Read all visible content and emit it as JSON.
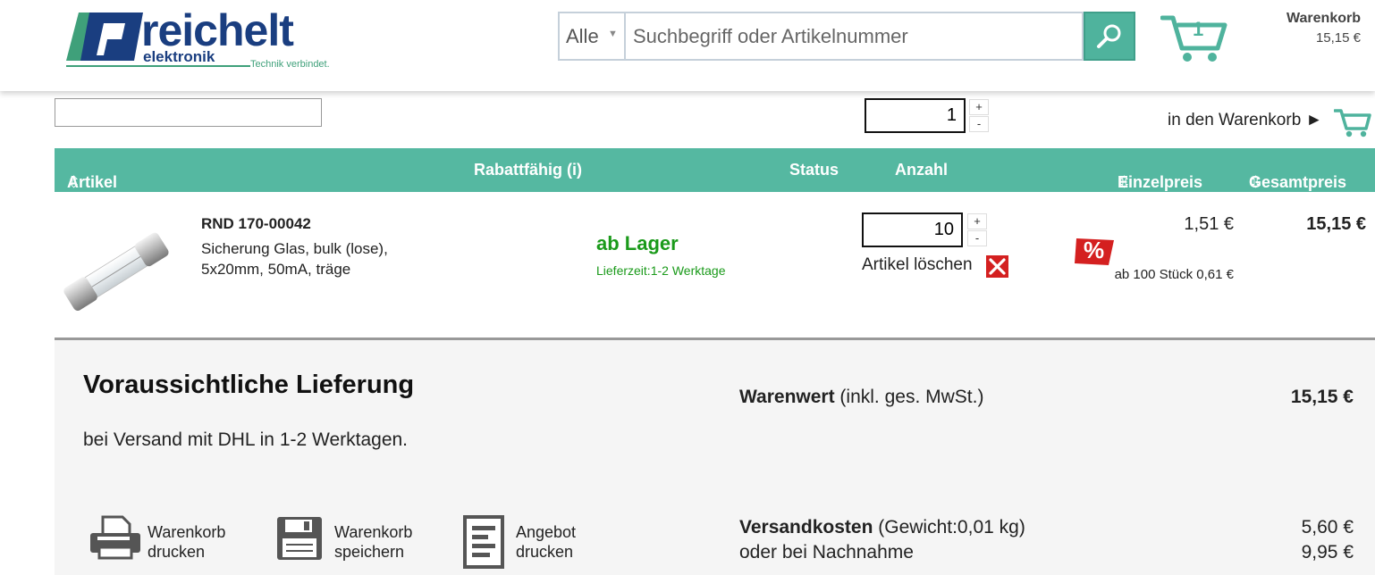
{
  "logo": {
    "word": "reichelt",
    "sub": "elektronik",
    "tagline": "Technik verbindet."
  },
  "search": {
    "category": "Alle",
    "placeholder": "Suchbegriff oder Artikelnummer"
  },
  "cart": {
    "count": "1",
    "label": "Warenkorb",
    "total": "15,15 €"
  },
  "toolbar": {
    "quantity": "1",
    "stepper_up": "+",
    "stepper_down": "-",
    "add_to_cart": "in den Warenkorb ►"
  },
  "table": {
    "columns": {
      "article": "Artikel",
      "discount": "Rabattfähig (i)",
      "status": "Status",
      "quantity": "Anzahl",
      "unit_price": "Einzelpreis",
      "total_price": "Gesamtpreis",
      "sort_glyph": "⇳"
    }
  },
  "item": {
    "sku": "RND 170-00042",
    "desc_line1": "Sicherung Glas, bulk (lose),",
    "desc_line2": "5x20mm, 50mA, träge",
    "stock": "ab Lager",
    "delivery": "Lieferzeit:1-2 Werktage",
    "quantity": "10",
    "delete_label": "Artikel löschen",
    "unit_price": "1,51 €",
    "discount_symbol": "%",
    "bulk_price": "ab 100 Stück 0,61 €",
    "total_price": "15,15 €"
  },
  "summary": {
    "delivery_title": "Voraussichtliche Lieferung",
    "delivery_text": "bei Versand mit DHL in 1-2 Werktagen.",
    "value_label_bold": "Warenwert",
    "value_label_rest": " (inkl. ges. MwSt.)",
    "value_amount": "15,15 €",
    "shipping_label_bold": "Versandkosten",
    "shipping_label_rest": " (Gewicht:0,01 kg)",
    "shipping_amount": "5,60 €",
    "cod_label": "oder bei Nachnahme",
    "cod_amount": "9,95 €"
  },
  "actions": {
    "print": {
      "line1": "Warenkorb",
      "line2": "drucken"
    },
    "save": {
      "line1": "Warenkorb",
      "line2": "speichern"
    },
    "offer": {
      "line1": "Angebot",
      "line2": "drucken"
    }
  },
  "colors": {
    "accent": "#55b8a1",
    "brand": "#1a3e80",
    "stock_green": "#1a9a1a",
    "delete_red": "#d42020"
  },
  "icons": [
    "logo-mark-icon",
    "search-icon",
    "cart-icon",
    "printer-icon",
    "floppy-disk-icon",
    "document-icon",
    "delete-icon",
    "discount-icon"
  ]
}
